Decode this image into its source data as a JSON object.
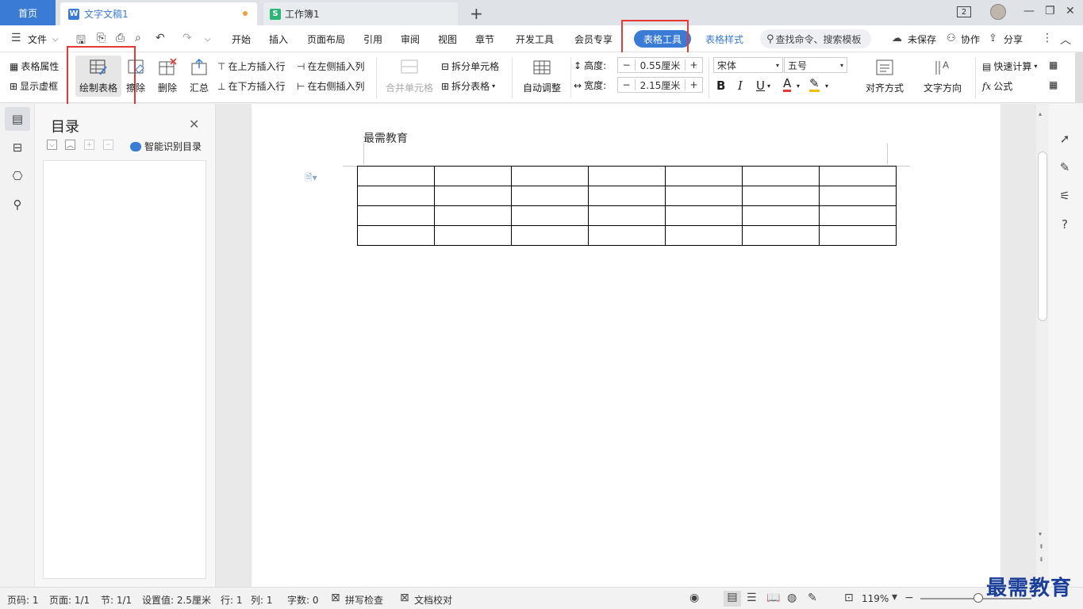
{
  "titlebar": {
    "home_tab": "首页",
    "doc_tab": "文字文稿1",
    "doc_badge": "W",
    "sheet_tab": "工作簿1",
    "sheet_badge": "S",
    "add_tab": "+",
    "window_count": "2"
  },
  "menu": {
    "file": "文件",
    "items": [
      "开始",
      "插入",
      "页面布局",
      "引用",
      "审阅",
      "视图",
      "章节",
      "开发工具",
      "会员专享"
    ],
    "active_tab": "表格工具",
    "table_style": "表格样式",
    "search_placeholder": "查找命令、搜索模板",
    "unsaved": "未保存",
    "collab": "协作",
    "share": "分享"
  },
  "ribbon": {
    "table_props": "表格属性",
    "show_gridlines": "显示虚框",
    "draw_table": "绘制表格",
    "eraser": "擦除",
    "delete": "删除",
    "summary": "汇总",
    "insert_row_above": "在上方插入行",
    "insert_row_below": "在下方插入行",
    "insert_col_left": "在左侧插入列",
    "insert_col_right": "在右侧插入列",
    "merge_cells": "合并单元格",
    "split_cells": "拆分单元格",
    "split_table": "拆分表格",
    "auto_fit": "自动调整",
    "height_label": "高度:",
    "height_value": "0.55厘米",
    "width_label": "宽度:",
    "width_value": "2.15厘米",
    "font_name": "宋体",
    "font_size": "五号",
    "align": "对齐方式",
    "text_direction": "文字方向",
    "quick_calc": "快速计算",
    "formula": "公式",
    "fx": "fx"
  },
  "toc": {
    "title": "目录",
    "smart": "智能识别目录"
  },
  "document": {
    "header": "最需教育",
    "table": {
      "rows": 4,
      "cols": 7
    }
  },
  "status": {
    "page_num": "页码: 1",
    "pages": "页面: 1/1",
    "section": "节: 1/1",
    "setting": "设置值: 2.5厘米",
    "row": "行: 1",
    "col": "列: 1",
    "words": "字数: 0",
    "spell": "拼写检查",
    "proof": "文档校对",
    "zoom": "119%"
  },
  "watermark": "最需教育",
  "colors": {
    "accent": "#3a7bd5",
    "highlight_box": "#e53935"
  }
}
